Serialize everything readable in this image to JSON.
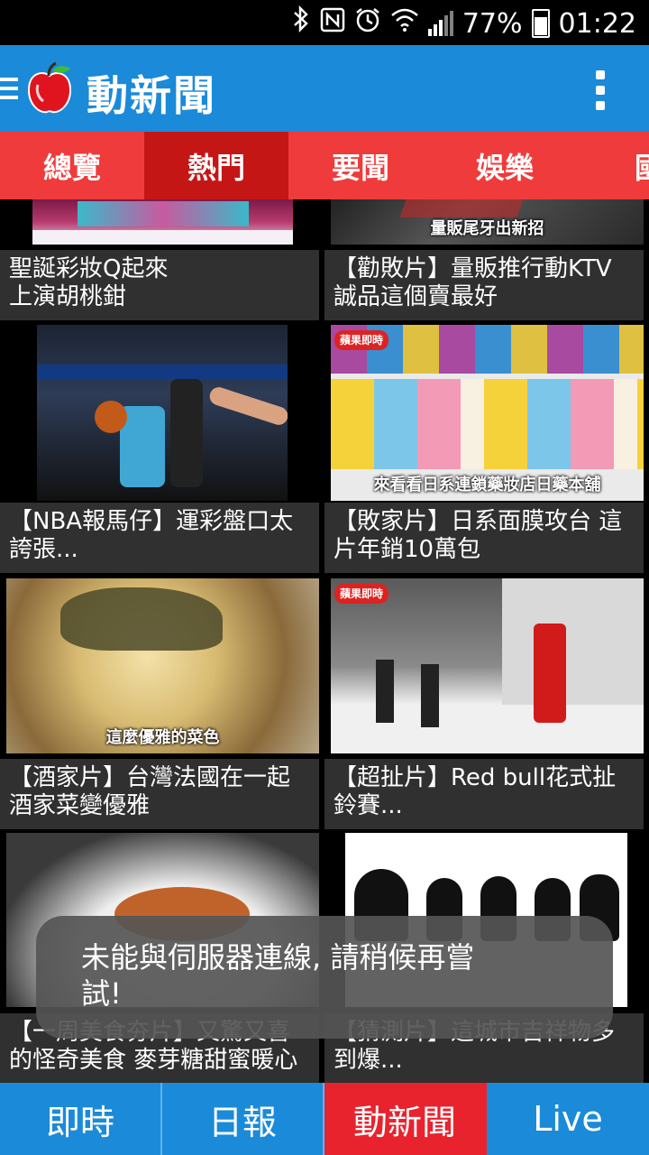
{
  "status_bar": {
    "battery_percent": "77%",
    "time": "01:22",
    "icons": [
      "bluetooth-icon",
      "nfc-icon",
      "alarm-icon",
      "wifi-icon",
      "signal-icon",
      "battery-icon"
    ]
  },
  "app_bar": {
    "title": "動新聞",
    "logo": "apple-logo-icon",
    "menu_icon": "hamburger-icon",
    "overflow_icon": "more-vert-icon"
  },
  "tabs": [
    "總覽",
    "熱門",
    "要聞",
    "娛樂",
    "國"
  ],
  "active_tab": "熱門",
  "videos": [
    {
      "caption": "聖誕彩妝Q起來\n上演胡桃鉗",
      "overlay": ""
    },
    {
      "caption": "【勸敗片】量販推行動KTV\n誠品這個賣最好",
      "overlay": "量販尾牙出新招"
    },
    {
      "caption": "【NBA報馬仔】運彩盤口太\n誇張...",
      "overlay": ""
    },
    {
      "caption": "【敗家片】日系面膜攻台 這\n片年銷10萬包",
      "overlay": "來看看日系連鎖藥妝店日藥本舖"
    },
    {
      "caption": "【酒家片】台灣法國在一起\n酒家菜變優雅",
      "overlay": "這麼優雅的菜色"
    },
    {
      "caption": "【超扯片】Red bull花式扯\n鈴賽...",
      "overlay": ""
    },
    {
      "caption": "【一周美食夯片】又驚又喜\n的怪奇美食 麥芽糖甜蜜暖心",
      "overlay": ""
    },
    {
      "caption": "【猜測片】這城市吉祥物多\n到爆...",
      "overlay": ""
    }
  ],
  "badge_text": "蘋果即時",
  "toast": {
    "message": "未能與伺服器連線, 請稍候再嘗\n試!"
  },
  "bottom_nav": [
    "即時",
    "日報",
    "動新聞",
    "Live"
  ],
  "bottom_nav_active": "動新聞",
  "colors": {
    "primary": "#1b8ad9",
    "tab_bar": "#ef3b3b",
    "tab_active": "#c51616",
    "nav_active": "#e8232e",
    "caption_bg": "#303030"
  }
}
